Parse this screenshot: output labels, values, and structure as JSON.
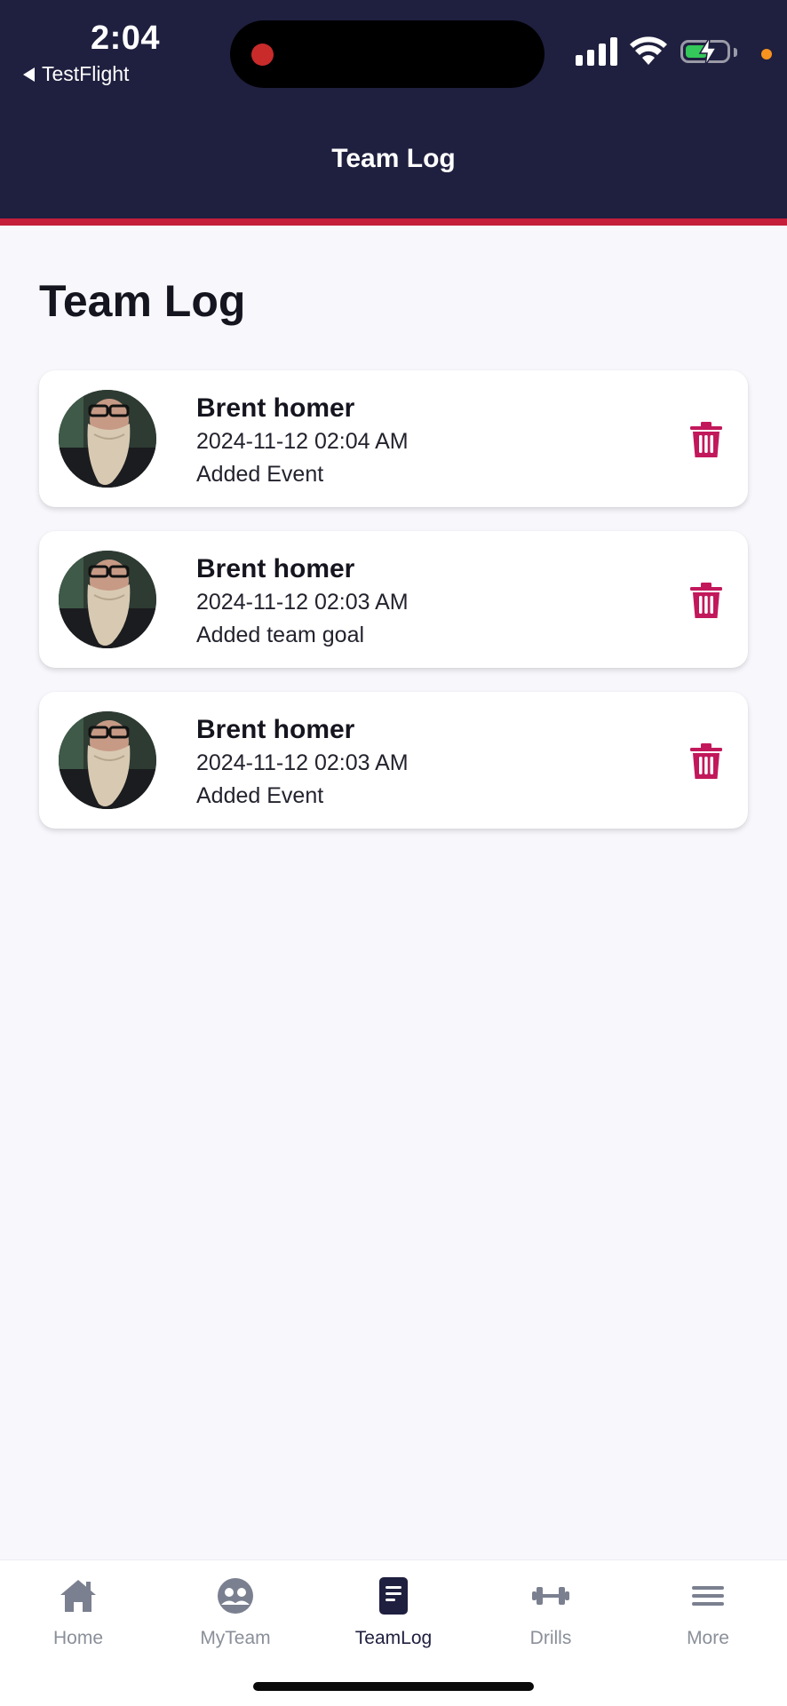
{
  "status_bar": {
    "time": "2:04",
    "back_label": "TestFlight"
  },
  "nav": {
    "title": "Team Log"
  },
  "page": {
    "title": "Team Log"
  },
  "log_entries": [
    {
      "name": "Brent homer",
      "timestamp": "2024-11-12 02:04 AM",
      "action": "Added Event"
    },
    {
      "name": "Brent homer",
      "timestamp": "2024-11-12 02:03 AM",
      "action": "Added team goal"
    },
    {
      "name": "Brent homer",
      "timestamp": "2024-11-12 02:03 AM",
      "action": "Added Event"
    }
  ],
  "tabs": [
    {
      "label": "Home",
      "icon": "home-icon",
      "active": false
    },
    {
      "label": "MyTeam",
      "icon": "team-icon",
      "active": false
    },
    {
      "label": "TeamLog",
      "icon": "document-icon",
      "active": true
    },
    {
      "label": "Drills",
      "icon": "dumbbell-icon",
      "active": false
    },
    {
      "label": "More",
      "icon": "menu-icon",
      "active": false
    }
  ],
  "colors": {
    "header_bg": "#1f1f3f",
    "accent_red": "#c41e3a",
    "delete_icon": "#c2185b",
    "page_bg": "#f7f7fc",
    "tab_inactive": "#8a8f99",
    "tab_active": "#1f1f3f"
  }
}
